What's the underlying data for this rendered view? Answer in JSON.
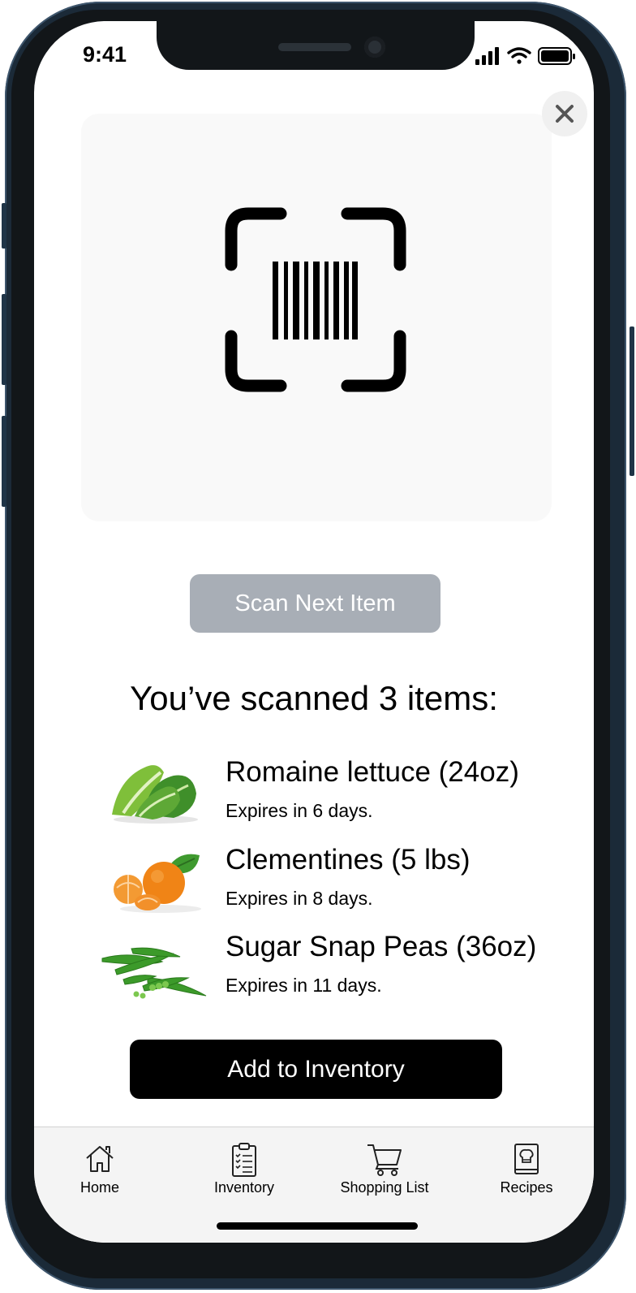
{
  "status_bar": {
    "time": "9:41"
  },
  "close_icon": "close-icon",
  "scanner": {
    "icon": "barcode-scan-icon"
  },
  "scan_next_label": "Scan Next Item",
  "scanned_heading": "You’ve scanned 3 items:",
  "items": [
    {
      "name": "Romaine lettuce (24oz)",
      "expires": "Expires in 6 days.",
      "image": "lettuce-image"
    },
    {
      "name": "Clementines (5 lbs)",
      "expires": "Expires in 8 days.",
      "image": "clementines-image"
    },
    {
      "name": "Sugar Snap Peas (36oz)",
      "expires": "Expires in 11 days.",
      "image": "snap-peas-image"
    }
  ],
  "add_to_inventory_label": "Add to Inventory",
  "tabs": [
    {
      "label": "Home",
      "icon": "home-icon"
    },
    {
      "label": "Inventory",
      "icon": "clipboard-icon"
    },
    {
      "label": "Shopping List",
      "icon": "cart-icon"
    },
    {
      "label": "Recipes",
      "icon": "recipe-book-icon"
    }
  ],
  "colors": {
    "frame": "#1b2a38",
    "scan_button": "#a8aeb6",
    "primary_button": "#000000",
    "tab_bar": "#f4f4f4"
  }
}
